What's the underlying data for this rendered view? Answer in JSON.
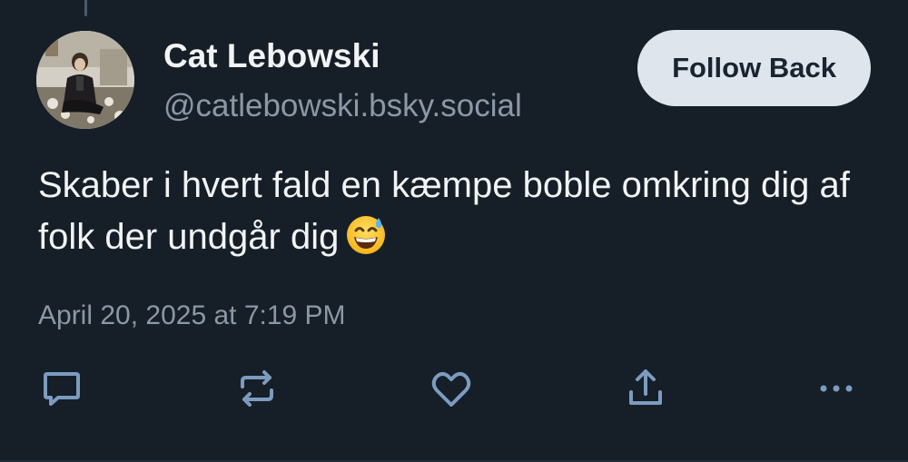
{
  "author": {
    "display_name": "Cat Lebowski",
    "handle": "@catlebowski.bsky.social"
  },
  "follow_button": {
    "label": "Follow Back"
  },
  "post": {
    "text": "Skaber i hvert fald en kæmpe boble omkring dig af folk der undgår dig",
    "emoji": "grinning-face-with-sweat-icon",
    "timestamp": "April 20, 2025 at 7:19 PM"
  },
  "actions": {
    "reply_icon": "speech-bubble-icon",
    "repost_icon": "repost-arrows-icon",
    "like_icon": "heart-outline-icon",
    "share_icon": "share-upload-icon",
    "more_icon": "more-dots-icon"
  },
  "colors": {
    "background": "#161e27",
    "primary_text": "#f1f3f5",
    "secondary_text": "#8b98a5",
    "button_bg": "#dfe5ec",
    "icon_color": "#7c9cbf"
  }
}
